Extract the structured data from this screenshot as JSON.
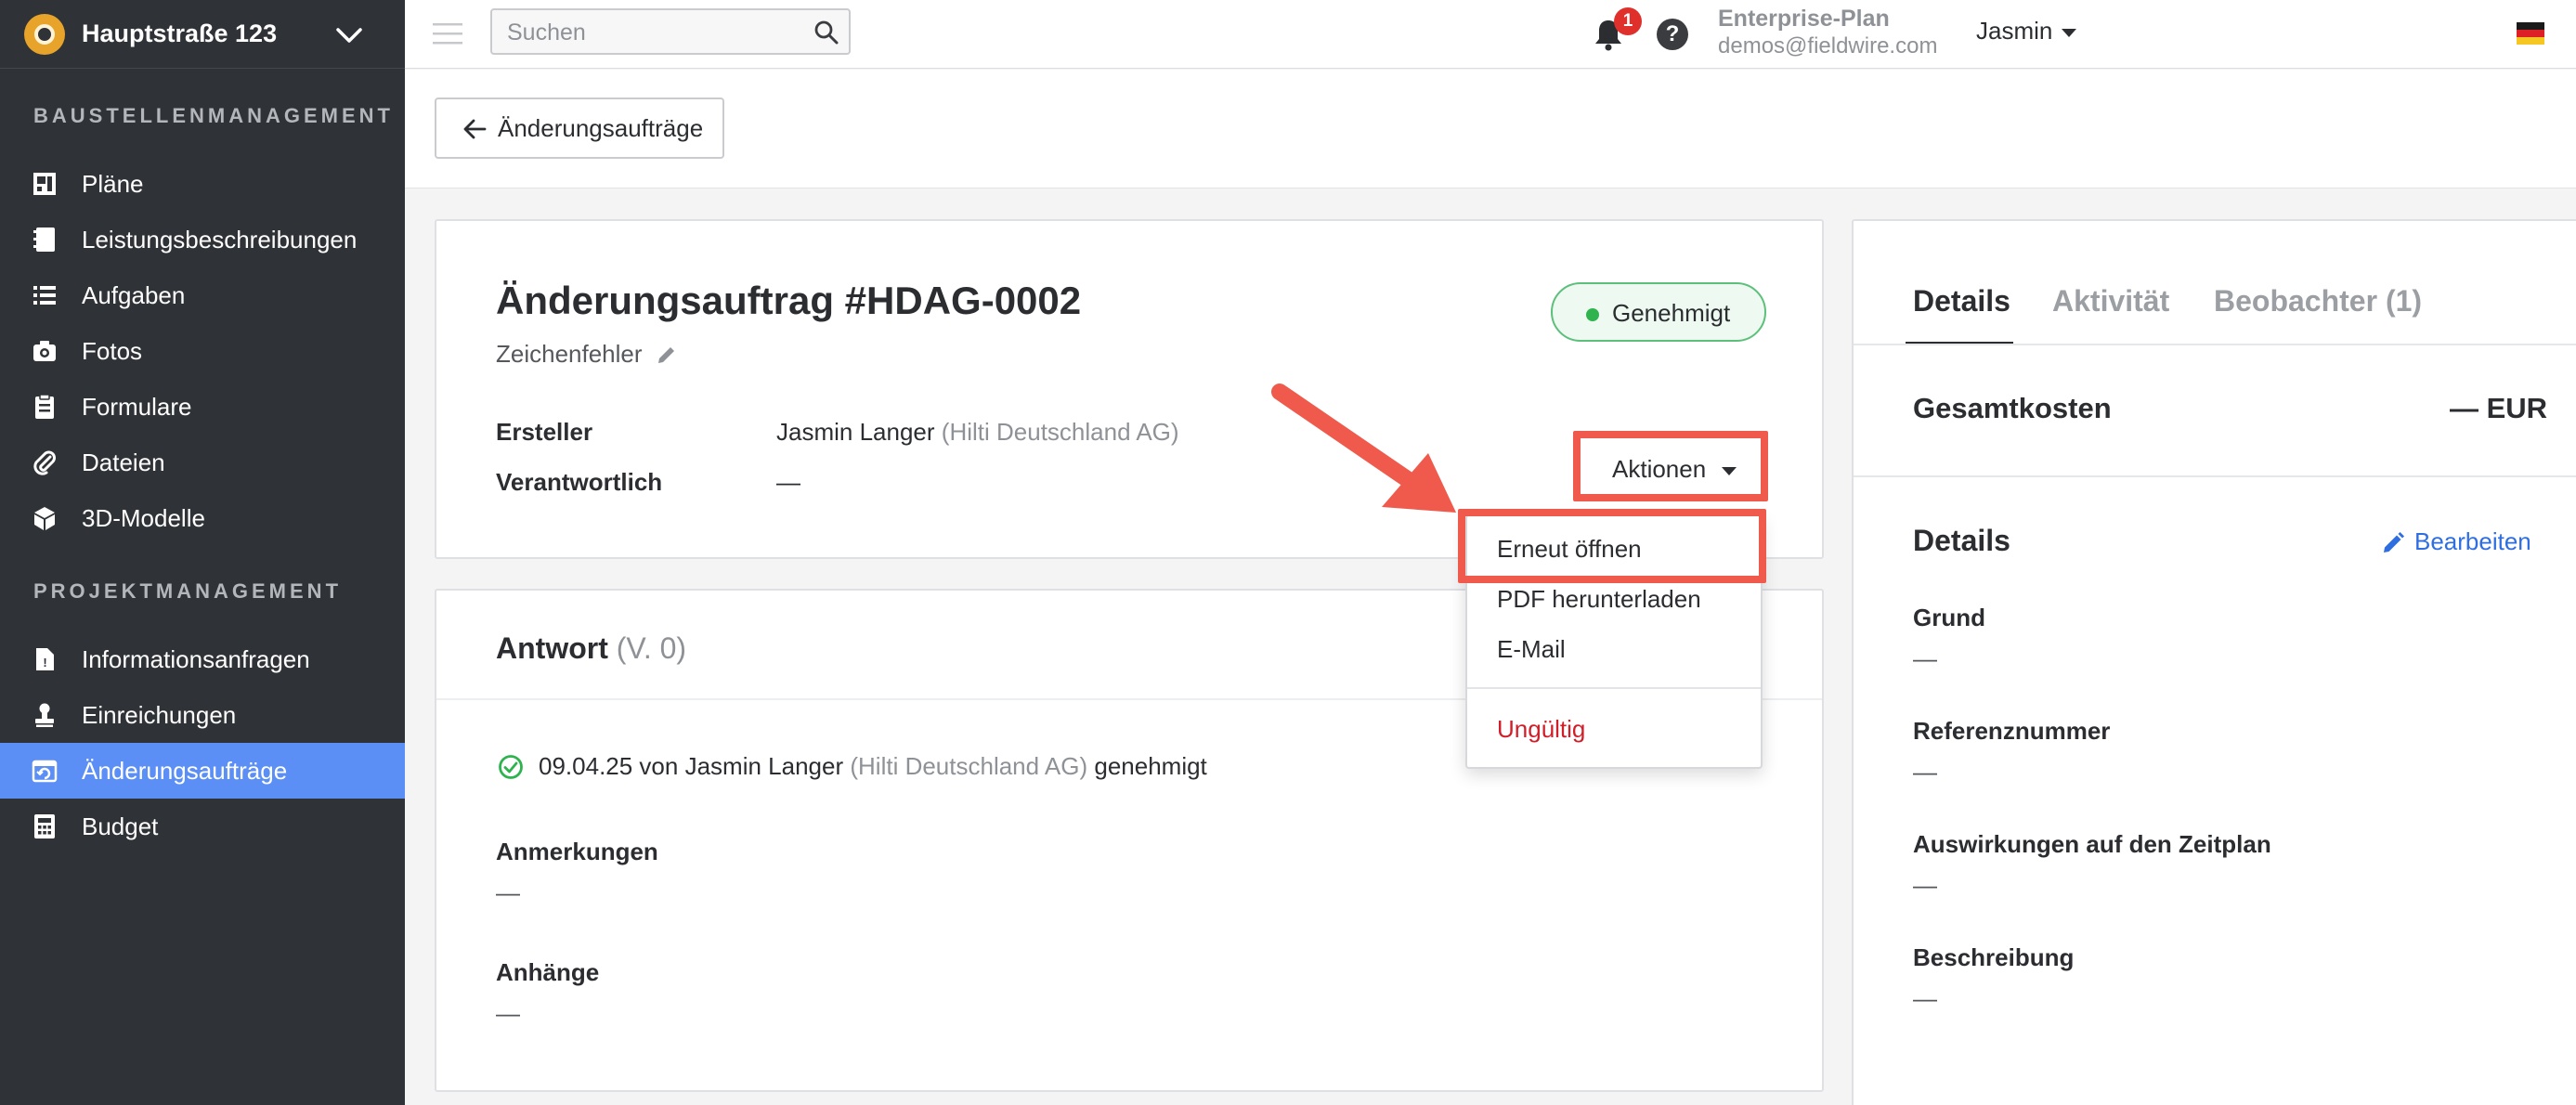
{
  "sidebar": {
    "project_name": "Hauptstraße 123",
    "section1": "BAUSTELLENMANAGEMENT",
    "section2": "PROJEKTMANAGEMENT",
    "items": [
      {
        "label": "Pläne",
        "icon": "plans-icon"
      },
      {
        "label": "Leistungsbeschreibungen",
        "icon": "specifications-icon"
      },
      {
        "label": "Aufgaben",
        "icon": "tasks-icon"
      },
      {
        "label": "Fotos",
        "icon": "camera-icon"
      },
      {
        "label": "Formulare",
        "icon": "forms-icon"
      },
      {
        "label": "Dateien",
        "icon": "paperclip-icon"
      },
      {
        "label": "3D-Modelle",
        "icon": "cube-icon"
      },
      {
        "label": "Informationsanfragen",
        "icon": "rfi-icon"
      },
      {
        "label": "Einreichungen",
        "icon": "stamp-icon"
      },
      {
        "label": "Änderungsaufträge",
        "icon": "change-order-icon",
        "active": true
      },
      {
        "label": "Budget",
        "icon": "calculator-icon"
      }
    ]
  },
  "topbar": {
    "search_placeholder": "Suchen",
    "notification_count": "1",
    "help": "?",
    "plan": "Enterprise-Plan",
    "email": "demos@fieldwire.com",
    "user": "Jasmin"
  },
  "back_button": "Änderungsaufträge",
  "change_order": {
    "title": "Änderungsauftrag #HDAG-0002",
    "subtitle": "Zeichenfehler",
    "status": "Genehmigt",
    "creator_label": "Ersteller",
    "creator_name": "Jasmin Langer",
    "creator_company": "(Hilti Deutschland AG)",
    "responsible_label": "Verantwortlich",
    "responsible_value": "—",
    "actions_label": "Aktionen"
  },
  "dropdown": {
    "items": [
      "Erneut öffnen",
      "PDF herunterladen",
      "E-Mail"
    ],
    "danger_item": "Ungültig"
  },
  "response": {
    "title": "Antwort",
    "version": "(V. 0)",
    "approval_date": "09.04.25 von Jasmin Langer",
    "approval_company": "(Hilti Deutschland AG)",
    "approval_status": "genehmigt",
    "notes_label": "Anmerkungen",
    "notes_value": "—",
    "attachments_label": "Anhänge",
    "attachments_value": "—"
  },
  "right_panel": {
    "tabs": [
      "Details",
      "Aktivität",
      "Beobachter (1)"
    ],
    "cost_label": "Gesamtkosten",
    "cost_value": "— EUR",
    "details_title": "Details",
    "edit_label": "Bearbeiten",
    "fields": [
      {
        "label": "Grund",
        "value": "—"
      },
      {
        "label": "Referenznummer",
        "value": "—"
      },
      {
        "label": "Auswirkungen auf den Zeitplan",
        "value": "—"
      },
      {
        "label": "Beschreibung",
        "value": "—"
      }
    ]
  },
  "colors": {
    "sidebar_bg": "#2f3236",
    "active_nav": "#5b8ff5",
    "annotation": "#ef5a4c",
    "status_green": "#2fb34f",
    "link_blue": "#2f6ee0",
    "danger_red": "#d11f2a"
  }
}
